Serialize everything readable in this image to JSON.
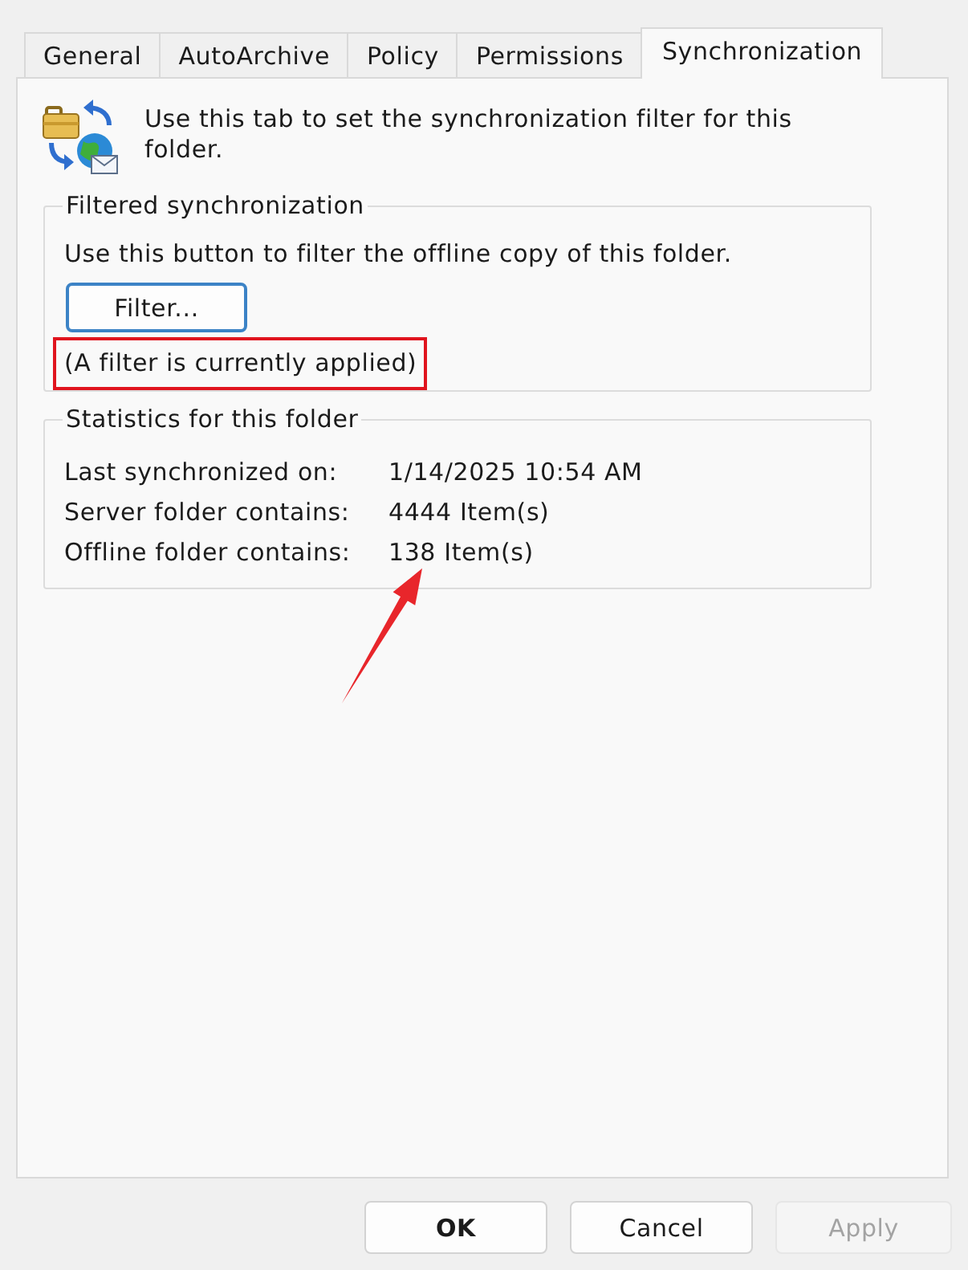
{
  "tabs": [
    {
      "label": "General",
      "selected": false
    },
    {
      "label": "AutoArchive",
      "selected": false
    },
    {
      "label": "Policy",
      "selected": false
    },
    {
      "label": "Permissions",
      "selected": false
    },
    {
      "label": "Synchronization",
      "selected": true
    }
  ],
  "header": {
    "description": "Use this tab to set the synchronization filter for this folder."
  },
  "filtered_sync": {
    "title": "Filtered synchronization",
    "instruction": "Use this button to filter the offline copy of this folder.",
    "filter_button": {
      "label": "Filter...",
      "focused": true
    },
    "status": {
      "text": "(A filter is currently applied)",
      "highlighted": true
    }
  },
  "statistics": {
    "title": "Statistics for this folder",
    "rows": [
      {
        "label": "Last synchronized on:",
        "value": "1/14/2025 10:54 AM",
        "pointed_at": false
      },
      {
        "label": "Server folder contains:",
        "value": "4444 Item(s)",
        "pointed_at": false
      },
      {
        "label": "Offline folder contains:",
        "value": "138 Item(s)",
        "pointed_at": true
      }
    ]
  },
  "buttons": [
    {
      "label": "OK",
      "default": true,
      "disabled": false
    },
    {
      "label": "Cancel",
      "default": false,
      "disabled": false
    },
    {
      "label": "Apply",
      "default": false,
      "disabled": true
    }
  ]
}
